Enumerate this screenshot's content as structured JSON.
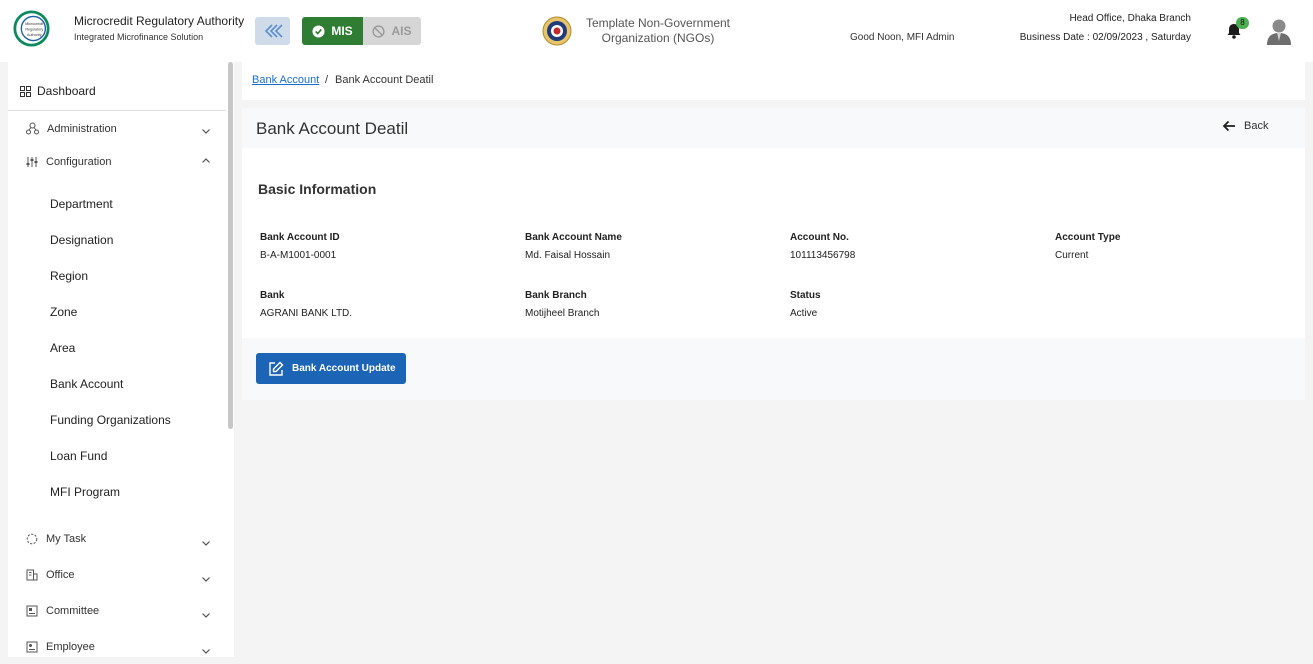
{
  "header": {
    "logo_text": "Microcredit Regulatory Authority",
    "org_title": "Microcredit Regulatory Authority",
    "org_subtitle": "Integrated Microfinance Solution",
    "mis_label": "MIS",
    "ais_label": "AIS",
    "ngo_name": "Template Non-Government Organization (NGOs)",
    "greeting": "Good Noon, MFI Admin",
    "branch": "Head Office, Dhaka Branch",
    "business_date": "Business Date : 02/09/2023 , Saturday",
    "notification_count": "8",
    "colors": {
      "mis": "#2e7d32",
      "primary": "#1c64b5",
      "badge": "#4caf50"
    }
  },
  "sidebar": {
    "dashboard": "Dashboard",
    "groups": [
      {
        "label": "Administration",
        "icon": "admin-icon",
        "expanded": false
      },
      {
        "label": "Configuration",
        "icon": "config-icon",
        "expanded": true
      },
      {
        "label": "My Task",
        "icon": "task-icon",
        "expanded": false
      },
      {
        "label": "Office",
        "icon": "office-icon",
        "expanded": false
      },
      {
        "label": "Committee",
        "icon": "committee-icon",
        "expanded": false
      },
      {
        "label": "Employee",
        "icon": "employee-icon",
        "expanded": false
      }
    ],
    "config_items": [
      "Department",
      "Designation",
      "Region",
      "Zone",
      "Area",
      "Bank Account",
      "Funding Organizations",
      "Loan Fund",
      "MFI Program"
    ]
  },
  "breadcrumb": {
    "parent": "Bank Account",
    "separator": "/",
    "current": "Bank Account Deatil"
  },
  "page": {
    "title": "Bank Account Deatil",
    "back_label": "Back",
    "section_title": "Basic Information",
    "fields": [
      {
        "label": "Bank Account ID",
        "value": "B-A-M1001-0001"
      },
      {
        "label": "Bank Account Name",
        "value": "Md. Faisal Hossain"
      },
      {
        "label": "Account No.",
        "value": "101113456798"
      },
      {
        "label": "Account Type",
        "value": "Current"
      },
      {
        "label": "Bank",
        "value": "AGRANI BANK LTD."
      },
      {
        "label": "Bank Branch",
        "value": "Motijheel Branch"
      },
      {
        "label": "Status",
        "value": "Active"
      }
    ],
    "update_button": "Bank Account Update"
  }
}
